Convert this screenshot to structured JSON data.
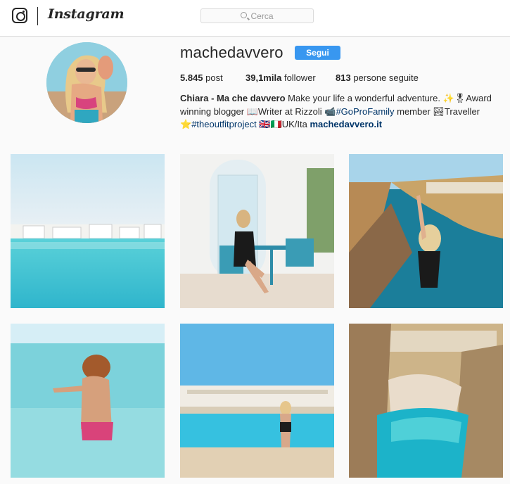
{
  "header": {
    "app_name": "Instagram",
    "search_placeholder": "Cerca",
    "icons": {
      "logo": "instagram-camera-icon",
      "search": "search-icon"
    }
  },
  "profile": {
    "username": "machedavvero",
    "follow_label": "Segui",
    "stats": {
      "posts_count": "5.845",
      "posts_label": "post",
      "followers_count": "39,1mila",
      "followers_label": "follower",
      "following_count": "813",
      "following_label": "persone seguite"
    },
    "bio": {
      "name": "Chiara - Ma che davvero",
      "text1": " Make your life a wonderful adventure. ✨🎖Award winning blogger 📖Writer at Rizzoli 📹",
      "hashtag1": "#GoProFamily",
      "text2": " member 🏞Traveller ⭐",
      "hashtag2": "#theoutfitproject",
      "text3": " 🇬🇧🇮🇹UK/Ita ",
      "website": "machedavvero.it"
    }
  },
  "posts": [
    {
      "subject": "pool with white buildings"
    },
    {
      "subject": "woman seated at blue table on terrace"
    },
    {
      "subject": "woman on cliff by the sea"
    },
    {
      "subject": "woman in turquoise sea"
    },
    {
      "subject": "woman by hotel pool"
    },
    {
      "subject": "beach in cove between cliffs"
    }
  ],
  "colors": {
    "accent": "#3897f0",
    "link": "#003569",
    "background": "#fafafa",
    "border": "#dbdbdb"
  }
}
